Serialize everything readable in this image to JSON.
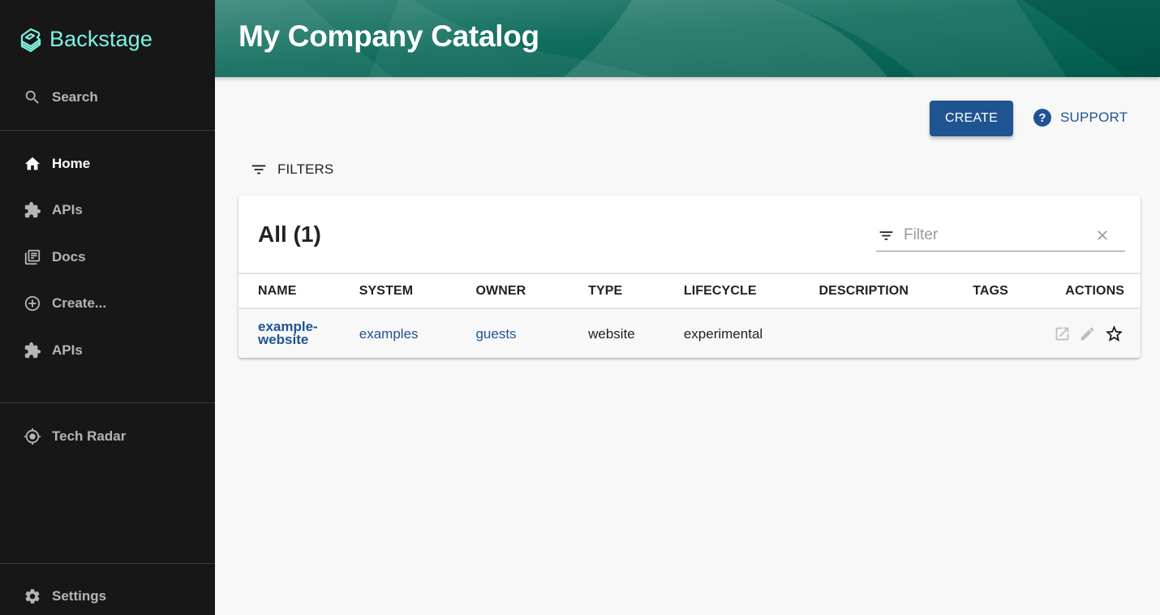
{
  "sidebar": {
    "brand": "Backstage",
    "search_label": "Search",
    "items": [
      {
        "label": "Home",
        "icon": "home-icon",
        "active": true
      },
      {
        "label": "APIs",
        "icon": "puzzle-icon"
      },
      {
        "label": "Docs",
        "icon": "library-books-icon"
      },
      {
        "label": "Create...",
        "icon": "add-circle-outline-icon"
      },
      {
        "label": "APIs",
        "icon": "puzzle-icon"
      }
    ],
    "plugins": [
      {
        "label": "Tech Radar",
        "icon": "radar-target-icon"
      }
    ],
    "settings_label": "Settings"
  },
  "header": {
    "title": "My Company Catalog"
  },
  "actions": {
    "create_label": "CREATE",
    "support_label": "SUPPORT",
    "filters_label": "FILTERS"
  },
  "colors": {
    "brand_teal": "#7df3e1",
    "primary_blue": "#1f5493",
    "header_green": "#005b4b",
    "sidebar_bg": "#171717"
  },
  "table": {
    "title": "All (1)",
    "filter_placeholder": "Filter",
    "filter_value": "",
    "columns": [
      "NAME",
      "SYSTEM",
      "OWNER",
      "TYPE",
      "LIFECYCLE",
      "DESCRIPTION",
      "TAGS",
      "ACTIONS"
    ],
    "rows": [
      {
        "name": "example-website",
        "name_line1": "example-",
        "name_line2": "website",
        "system": "examples",
        "owner": "guests",
        "type": "website",
        "lifecycle": "experimental",
        "description": "",
        "tags": "",
        "actions": [
          "open-in-new-icon",
          "edit-icon",
          "star-outline-icon"
        ]
      }
    ]
  }
}
